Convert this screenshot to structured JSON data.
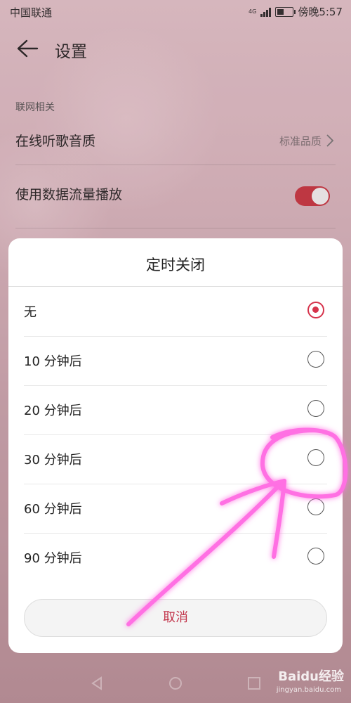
{
  "status_bar": {
    "carrier": "中国联通",
    "network": "4G",
    "time": "傍晚5:57",
    "battery_level": 0.45
  },
  "header": {
    "title": "设置",
    "back_icon": "arrow-left-icon"
  },
  "settings": {
    "section_label": "联网相关",
    "items": [
      {
        "label": "在线听歌音质",
        "value": "标准品质"
      },
      {
        "label": "使用数据流量播放",
        "toggle_on": true
      }
    ]
  },
  "dialog": {
    "title": "定时关闭",
    "options": [
      {
        "label": "无",
        "selected": true
      },
      {
        "label": "10 分钟后",
        "selected": false
      },
      {
        "label": "20 分钟后",
        "selected": false
      },
      {
        "label": "30 分钟后",
        "selected": false
      },
      {
        "label": "60 分钟后",
        "selected": false
      },
      {
        "label": "90 分钟后",
        "selected": false
      }
    ],
    "cancel_label": "取消"
  },
  "colors": {
    "accent": "#d6334b",
    "toggle": "#c8343f",
    "annotation": "#ff4fd8"
  },
  "watermark": {
    "brand": "Baidu经验",
    "url": "jingyan.baidu.com"
  }
}
